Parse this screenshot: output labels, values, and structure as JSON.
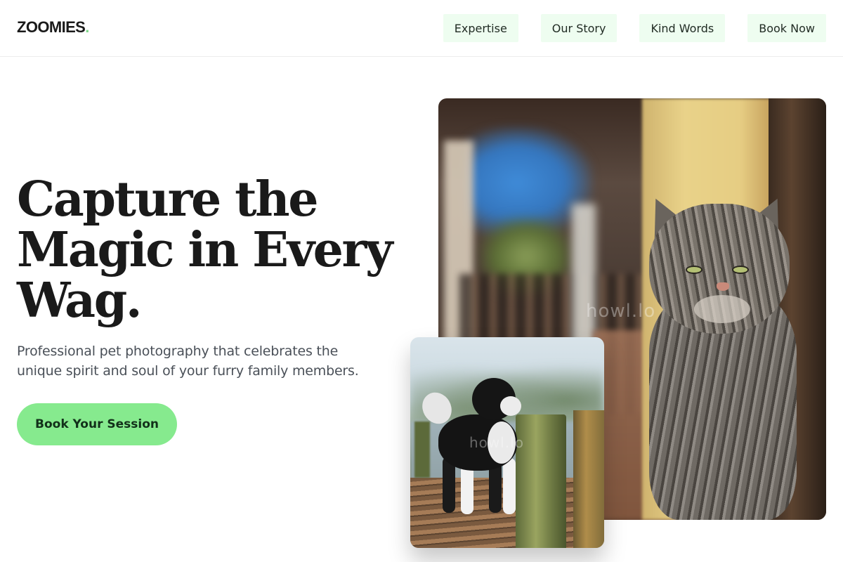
{
  "brand": {
    "name": "ZOOMIES",
    "dot": "."
  },
  "nav": {
    "items": [
      {
        "label": "Expertise"
      },
      {
        "label": "Our Story"
      },
      {
        "label": "Kind Words"
      },
      {
        "label": "Book Now"
      }
    ]
  },
  "hero": {
    "title_lines": [
      "Capture the",
      "Magic in Every",
      "Wag."
    ],
    "subtitle": "Professional pet photography that celebrates the unique spirit and soul of your furry family members.",
    "cta_label": "Book Your Session"
  },
  "photos": {
    "main_watermark": "howl.lo",
    "inset_watermark": "howl.lo"
  },
  "colors": {
    "accent": "#86ea8e",
    "nav_bg": "#eefdf0",
    "text": "#1a1a1a",
    "subtext": "#4a5058"
  }
}
